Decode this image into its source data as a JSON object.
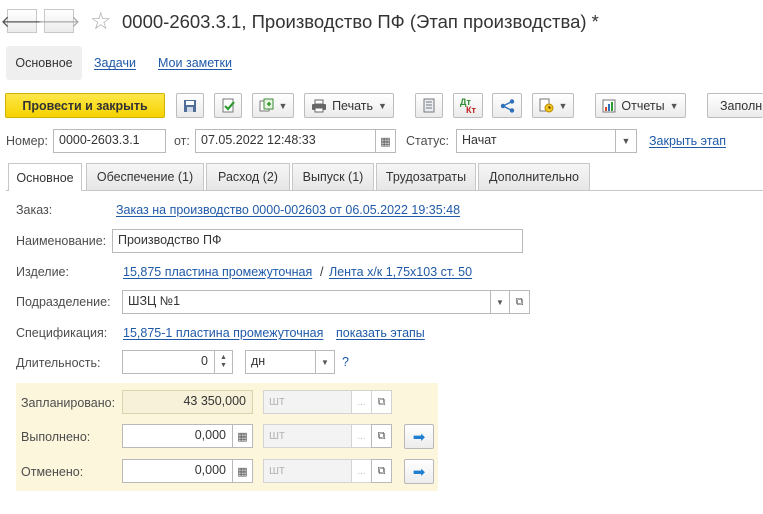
{
  "window": {
    "title": "0000-2603.3.1, Производство ПФ (Этап производства) *"
  },
  "subnav": {
    "main": "Основное",
    "tasks": "Задачи",
    "notes": "Мои заметки"
  },
  "toolbar": {
    "post_close": "Провести и закрыть",
    "print": "Печать",
    "reports": "Отчеты",
    "fill": "Заполн",
    "dt_kt_top": "Дт",
    "dt_kt_bottom": "Кт"
  },
  "header": {
    "number_label": "Номер:",
    "number_value": "0000-2603.3.1",
    "date_label": "от:",
    "date_value": "07.05.2022 12:48:33",
    "status_label": "Статус:",
    "status_value": "Начат",
    "close_stage_link": "Закрыть этап"
  },
  "tabs": [
    {
      "label": "Основное"
    },
    {
      "label": "Обеспечение (1)"
    },
    {
      "label": "Расход (2)"
    },
    {
      "label": "Выпуск (1)"
    },
    {
      "label": "Трудозатраты"
    },
    {
      "label": "Дополнительно"
    }
  ],
  "form": {
    "order_label": "Заказ:",
    "order_link": "Заказ на производство 0000-002603 от 06.05.2022 19:35:48",
    "name_label": "Наименование:",
    "name_value": "Производство ПФ",
    "product_label": "Изделие:",
    "product_link": "15,875 пластина промежуточная",
    "product_separator": "/",
    "product_link2": "Лента х/к 1,75х103 ст. 50",
    "department_label": "Подразделение:",
    "department_value": "ШЗЦ №1",
    "spec_label": "Спецификация:",
    "spec_link": "15,875-1 пластина промежуточная",
    "spec_stages_link": "показать этапы",
    "duration_label": "Длительность:",
    "duration_value": "0",
    "duration_unit": "дн",
    "help": "?"
  },
  "quantities": {
    "planned_label": "Запланировано:",
    "planned_value": "43 350,000",
    "planned_unit": "шт",
    "done_label": "Выполнено:",
    "done_value": "0,000",
    "done_unit": "шт",
    "cancelled_label": "Отменено:",
    "cancelled_value": "0,000",
    "cancelled_unit": "шт",
    "dots": "..."
  }
}
